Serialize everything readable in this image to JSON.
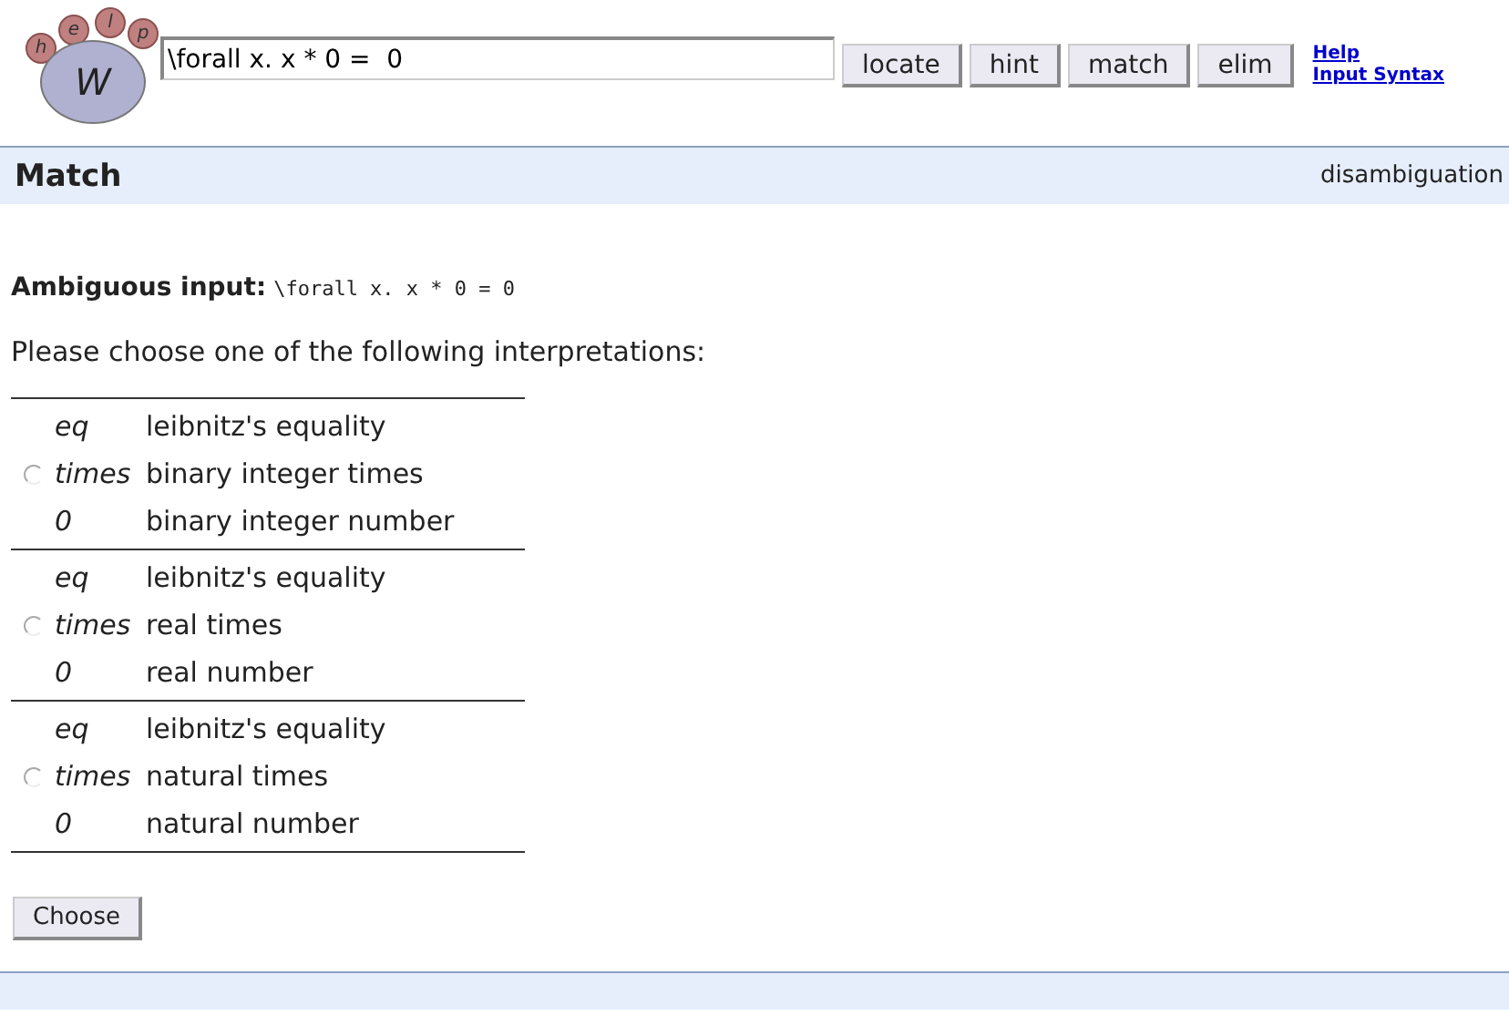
{
  "logo": {
    "letters": [
      "h",
      "e",
      "l",
      "p"
    ],
    "main": "W"
  },
  "search": {
    "value": "\\forall x. x * 0 =  0"
  },
  "buttons": [
    "locate",
    "hint",
    "match",
    "elim"
  ],
  "links": [
    "Help",
    "Input Syntax"
  ],
  "header": {
    "title": "Match",
    "right": "disambiguation"
  },
  "ambiguous": {
    "label": "Ambiguous input:",
    "input": "\\forall x. x * 0 = 0"
  },
  "prompt": "Please choose one of the following interpretations:",
  "interpretations": [
    {
      "selected": false,
      "rows": [
        {
          "symbol": "eq",
          "meaning": "leibnitz's equality"
        },
        {
          "symbol": "times",
          "meaning": "binary integer times"
        },
        {
          "symbol": "0",
          "meaning": "binary integer number"
        }
      ]
    },
    {
      "selected": false,
      "rows": [
        {
          "symbol": "eq",
          "meaning": "leibnitz's equality"
        },
        {
          "symbol": "times",
          "meaning": "real times"
        },
        {
          "symbol": "0",
          "meaning": "real number"
        }
      ]
    },
    {
      "selected": false,
      "rows": [
        {
          "symbol": "eq",
          "meaning": "leibnitz's equality"
        },
        {
          "symbol": "times",
          "meaning": "natural times"
        },
        {
          "symbol": "0",
          "meaning": "natural number"
        }
      ]
    }
  ],
  "submit": "Choose"
}
